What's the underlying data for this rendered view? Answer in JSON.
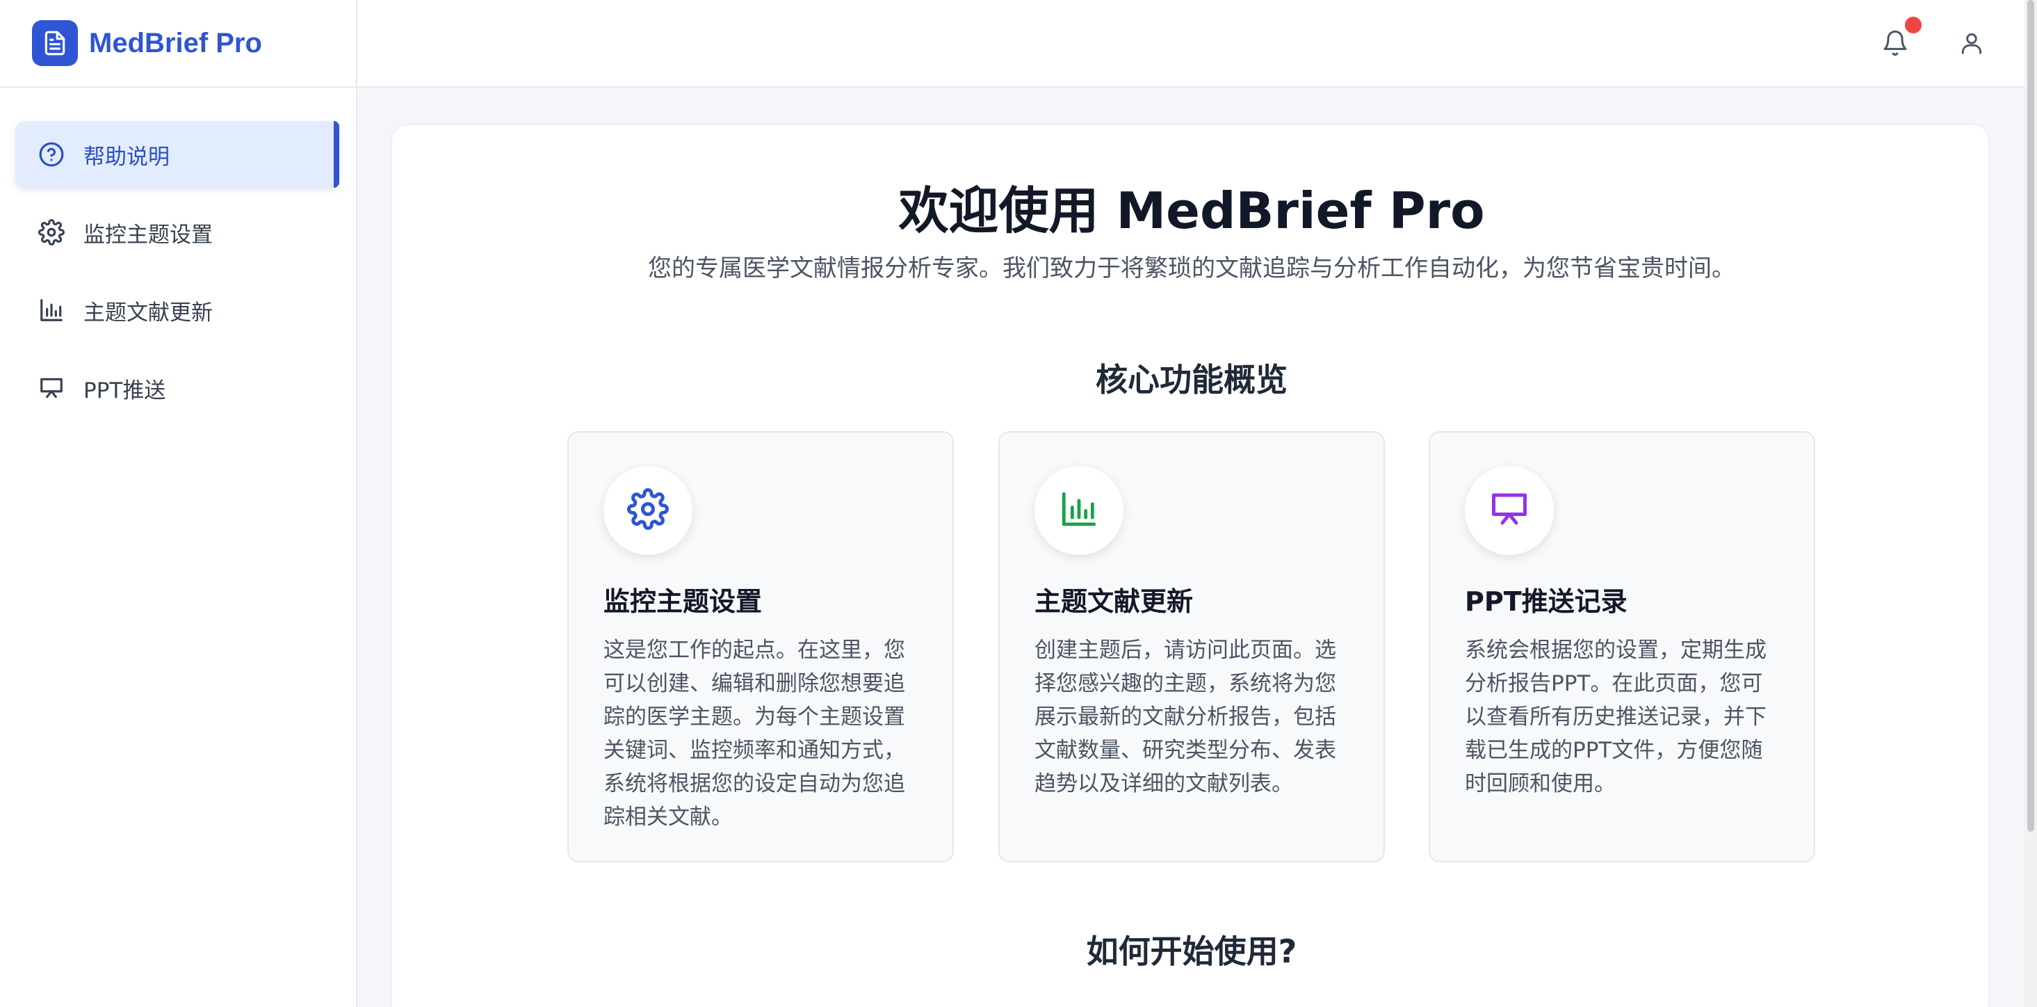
{
  "app": {
    "name": "MedBrief Pro"
  },
  "sidebar": {
    "items": [
      {
        "label": "帮助说明",
        "icon": "help-circle-icon",
        "active": true
      },
      {
        "label": "监控主题设置",
        "icon": "gear-icon",
        "active": false
      },
      {
        "label": "主题文献更新",
        "icon": "bar-chart-icon",
        "active": false
      },
      {
        "label": "PPT推送",
        "icon": "presentation-icon",
        "active": false
      }
    ]
  },
  "topbar": {
    "notification_icon": "bell-icon",
    "profile_icon": "user-icon"
  },
  "main": {
    "title": "欢迎使用 MedBrief Pro",
    "subtitle": "您的专属医学文献情报分析专家。我们致力于将繁琐的文献追踪与分析工作自动化，为您节省宝贵时间。",
    "overview_title": "核心功能概览",
    "features": [
      {
        "title": "监控主题设置",
        "icon": "gear-icon",
        "color": "#2f55d4",
        "description": "这是您工作的起点。在这里，您可以创建、编辑和删除您想要追踪的医学主题。为每个主题设置关键词、监控频率和通知方式，系统将根据您的设定自动为您追踪相关文献。"
      },
      {
        "title": "主题文献更新",
        "icon": "bar-chart-icon",
        "color": "#16a34a",
        "description": "创建主题后，请访问此页面。选择您感兴趣的主题，系统将为您展示最新的文献分析报告，包括文献数量、研究类型分布、发表趋势以及详细的文献列表。"
      },
      {
        "title": "PPT推送记录",
        "icon": "presentation-icon",
        "color": "#9333ea",
        "description": "系统会根据您的设置，定期生成分析报告PPT。在此页面，您可以查看所有历史推送记录，并下载已生成的PPT文件，方便您随时回顾和使用。"
      }
    ],
    "getting_started_title": "如何开始使用?"
  },
  "colors": {
    "accent": "#2f55d4",
    "active_bg": "#e3ecfc",
    "badge": "#ef4444"
  }
}
